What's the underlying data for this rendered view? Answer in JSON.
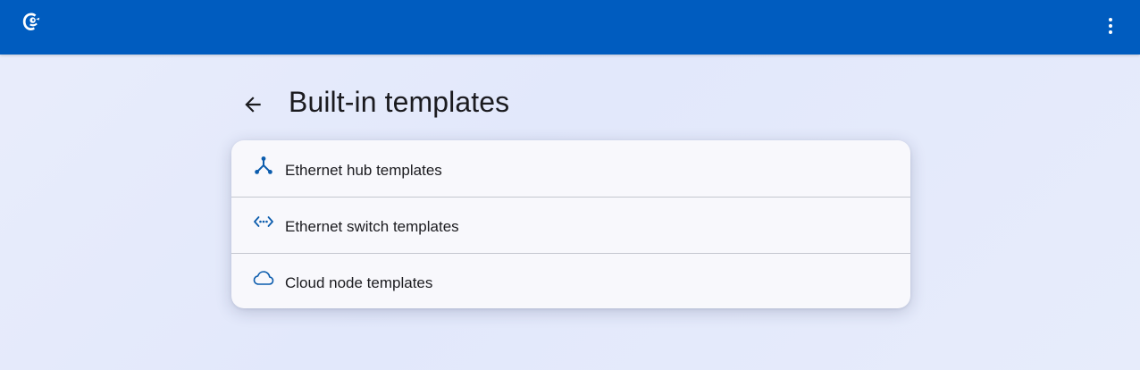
{
  "header": {
    "logo_icon": "gns3-chameleon-logo-icon",
    "menu_icon": "more-vert-icon",
    "bar_color": "#005cbf"
  },
  "page": {
    "back_icon": "arrow-back-icon",
    "title": "Built-in templates"
  },
  "templates": {
    "items": [
      {
        "label": "Ethernet hub templates",
        "icon": "hub-icon"
      },
      {
        "label": "Ethernet switch templates",
        "icon": "switch-icon"
      },
      {
        "label": "Cloud node templates",
        "icon": "cloud-icon"
      }
    ]
  },
  "colors": {
    "icon_accent": "#0b5cad",
    "text": "#1b1b1f"
  }
}
